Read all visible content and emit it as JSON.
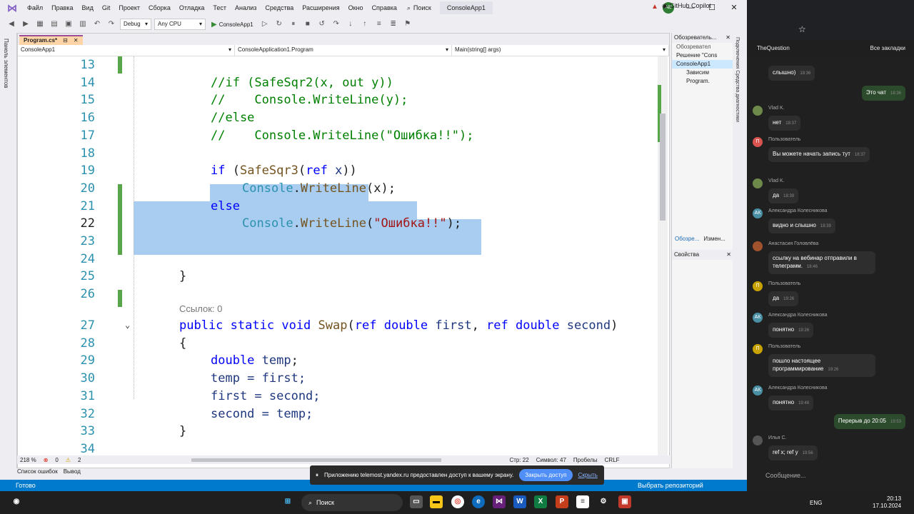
{
  "vs": {
    "menu": [
      "Файл",
      "Правка",
      "Вид",
      "Git",
      "Проект",
      "Сборка",
      "Отладка",
      "Тест",
      "Анализ",
      "Средства",
      "Расширения",
      "Окно",
      "Справка"
    ],
    "search_label": "Поиск",
    "solution_title": "ConsoleApp1",
    "avatar_initials": "AB",
    "copilot_label": "GitHub Copilot",
    "config": "Debug",
    "platform": "Any CPU",
    "run_label": "ConsoleApp1",
    "doc_tab": "Program.cs*",
    "nav": [
      "ConsoleApp1",
      "ConsoleApplication1.Program",
      "Main(string[] args)"
    ],
    "left_strip": "Панель элементов",
    "references_lens": "Ссылок: 0",
    "zoom": "218 %",
    "errors": "0",
    "warnings": "2",
    "position": "Стр: 22",
    "column": "Символ: 47",
    "spaces": "Пробелы",
    "eol": "CRLF",
    "bottom_tabs": [
      "Список ошибок",
      "Вывод"
    ],
    "status_ready": "Готово",
    "status_repo": "Выбрать репозиторий",
    "right_pane": {
      "title": "Обозреватель...",
      "toolbar_title": "Обозревател",
      "items": [
        "Решение \"Cons",
        "ConsoleApp1",
        "Зависим",
        "Program."
      ],
      "tabs": [
        "Обозре...",
        "Измен..."
      ],
      "props_title": "Свойства"
    },
    "right_strip": "Подключения Средства диагностики"
  },
  "code_lines": [
    {
      "n": "13"
    },
    {
      "n": "14"
    },
    {
      "n": "15"
    },
    {
      "n": "16"
    },
    {
      "n": "17"
    },
    {
      "n": "18"
    },
    {
      "n": "19"
    },
    {
      "n": "20"
    },
    {
      "n": "21"
    },
    {
      "n": "22"
    },
    {
      "n": "23"
    },
    {
      "n": "24"
    },
    {
      "n": "25"
    },
    {
      "n": "26"
    },
    {
      "n": "27"
    },
    {
      "n": "28"
    },
    {
      "n": "29"
    },
    {
      "n": "30"
    },
    {
      "n": "31"
    },
    {
      "n": "32"
    },
    {
      "n": "33"
    },
    {
      "n": "34"
    }
  ],
  "code": {
    "l14": "//if (SafeSqr2(x, out y))",
    "l15": "//    Console.WriteLine(y);",
    "l16": "//else",
    "l17": "//    Console.WriteLine(\"Ошибка!!\");",
    "l19_kw": "if",
    "l19_rest_open": " (",
    "l19_method": "SafeSqr3",
    "l19_args_open": "(",
    "l19_ref": "ref",
    "l19_var": " x",
    "l19_close": "))",
    "console": "Console",
    "dot": ".",
    "writeline": "WriteLine",
    "l20_args": "(x);",
    "l21_kw": "else",
    "l22_open": "(",
    "l22_str": "\"Ошибка!!\"",
    "l22_close": ");",
    "brace_close": "}",
    "brace_open": "{",
    "l27_public": "public",
    "l27_static": "static",
    "l27_void": "void",
    "l27_method": "Swap",
    "l27_ref1": "ref",
    "l27_double1": "double",
    "l27_first": "first",
    "l27_ref2": "ref",
    "l27_double2": "double",
    "l27_second": "second",
    "l29_double": "double",
    "l29_temp": "temp",
    "l30": "temp = first;",
    "l31": "first = second;",
    "l32": "second = temp;"
  },
  "toast": {
    "message": "Приложению telemost.yandex.ru предоставлен доступ к вашему экрану.",
    "close_access": "Закрыть доступ",
    "hide": "Скрыть"
  },
  "browser": {
    "bookmark": "TheQuestion",
    "all_bookmarks": "Все закладки",
    "input_placeholder": "Сообщение...",
    "messages": [
      {
        "name": "",
        "text": "слышно)",
        "time": "18:36",
        "mine": false,
        "initials": "",
        "color": ""
      },
      {
        "name": "",
        "text": "Это чат",
        "time": "18:36",
        "mine": true,
        "initials": "",
        "color": ""
      },
      {
        "name": "Vlad K.",
        "text": "нет",
        "time": "18:37",
        "mine": false,
        "initials": "",
        "color": "#6d8a4a"
      },
      {
        "name": "Пользователь",
        "text": "Вы можете начать запись тут",
        "time": "18:37",
        "mine": false,
        "initials": "П",
        "color": "#d9534f"
      },
      {
        "name": "Vlad K.",
        "text": "да",
        "time": "18:39",
        "mine": false,
        "initials": "",
        "color": "#6d8a4a"
      },
      {
        "name": "Александра Колесникова",
        "text": "видно и слышно",
        "time": "18:39",
        "mine": false,
        "initials": "АК",
        "color": "#4a90a4"
      },
      {
        "name": "Анастасия Головлёва",
        "text": "ссылку на вебинар отправили в телеграмм.",
        "time": "18:46",
        "mine": false,
        "initials": "",
        "color": "#a0522d"
      },
      {
        "name": "Пользователь",
        "text": "да",
        "time": "19:26",
        "mine": false,
        "initials": "П",
        "color": "#c8a200"
      },
      {
        "name": "Александра Колесникова",
        "text": "понятно",
        "time": "19:26",
        "mine": false,
        "initials": "АК",
        "color": "#4a90a4"
      },
      {
        "name": "Пользователь",
        "text": "пошло настоящее программирование",
        "time": "19:26",
        "mine": false,
        "initials": "П",
        "color": "#c8a200"
      },
      {
        "name": "Александра Колесникова",
        "text": "понятно",
        "time": "19:48",
        "mine": false,
        "initials": "АК",
        "color": "#4a90a4"
      },
      {
        "name": "",
        "text": "Перерыв до 20:05",
        "time": "19:53",
        "mine": true,
        "initials": "",
        "color": ""
      },
      {
        "name": "Илья С.",
        "text": "ref x; ref y",
        "time": "19:56",
        "mine": false,
        "initials": "",
        "color": "#555"
      }
    ]
  },
  "taskbar": {
    "search": "Поиск",
    "lang": "ENG",
    "time": "20:13",
    "date": "17.10.2024"
  }
}
